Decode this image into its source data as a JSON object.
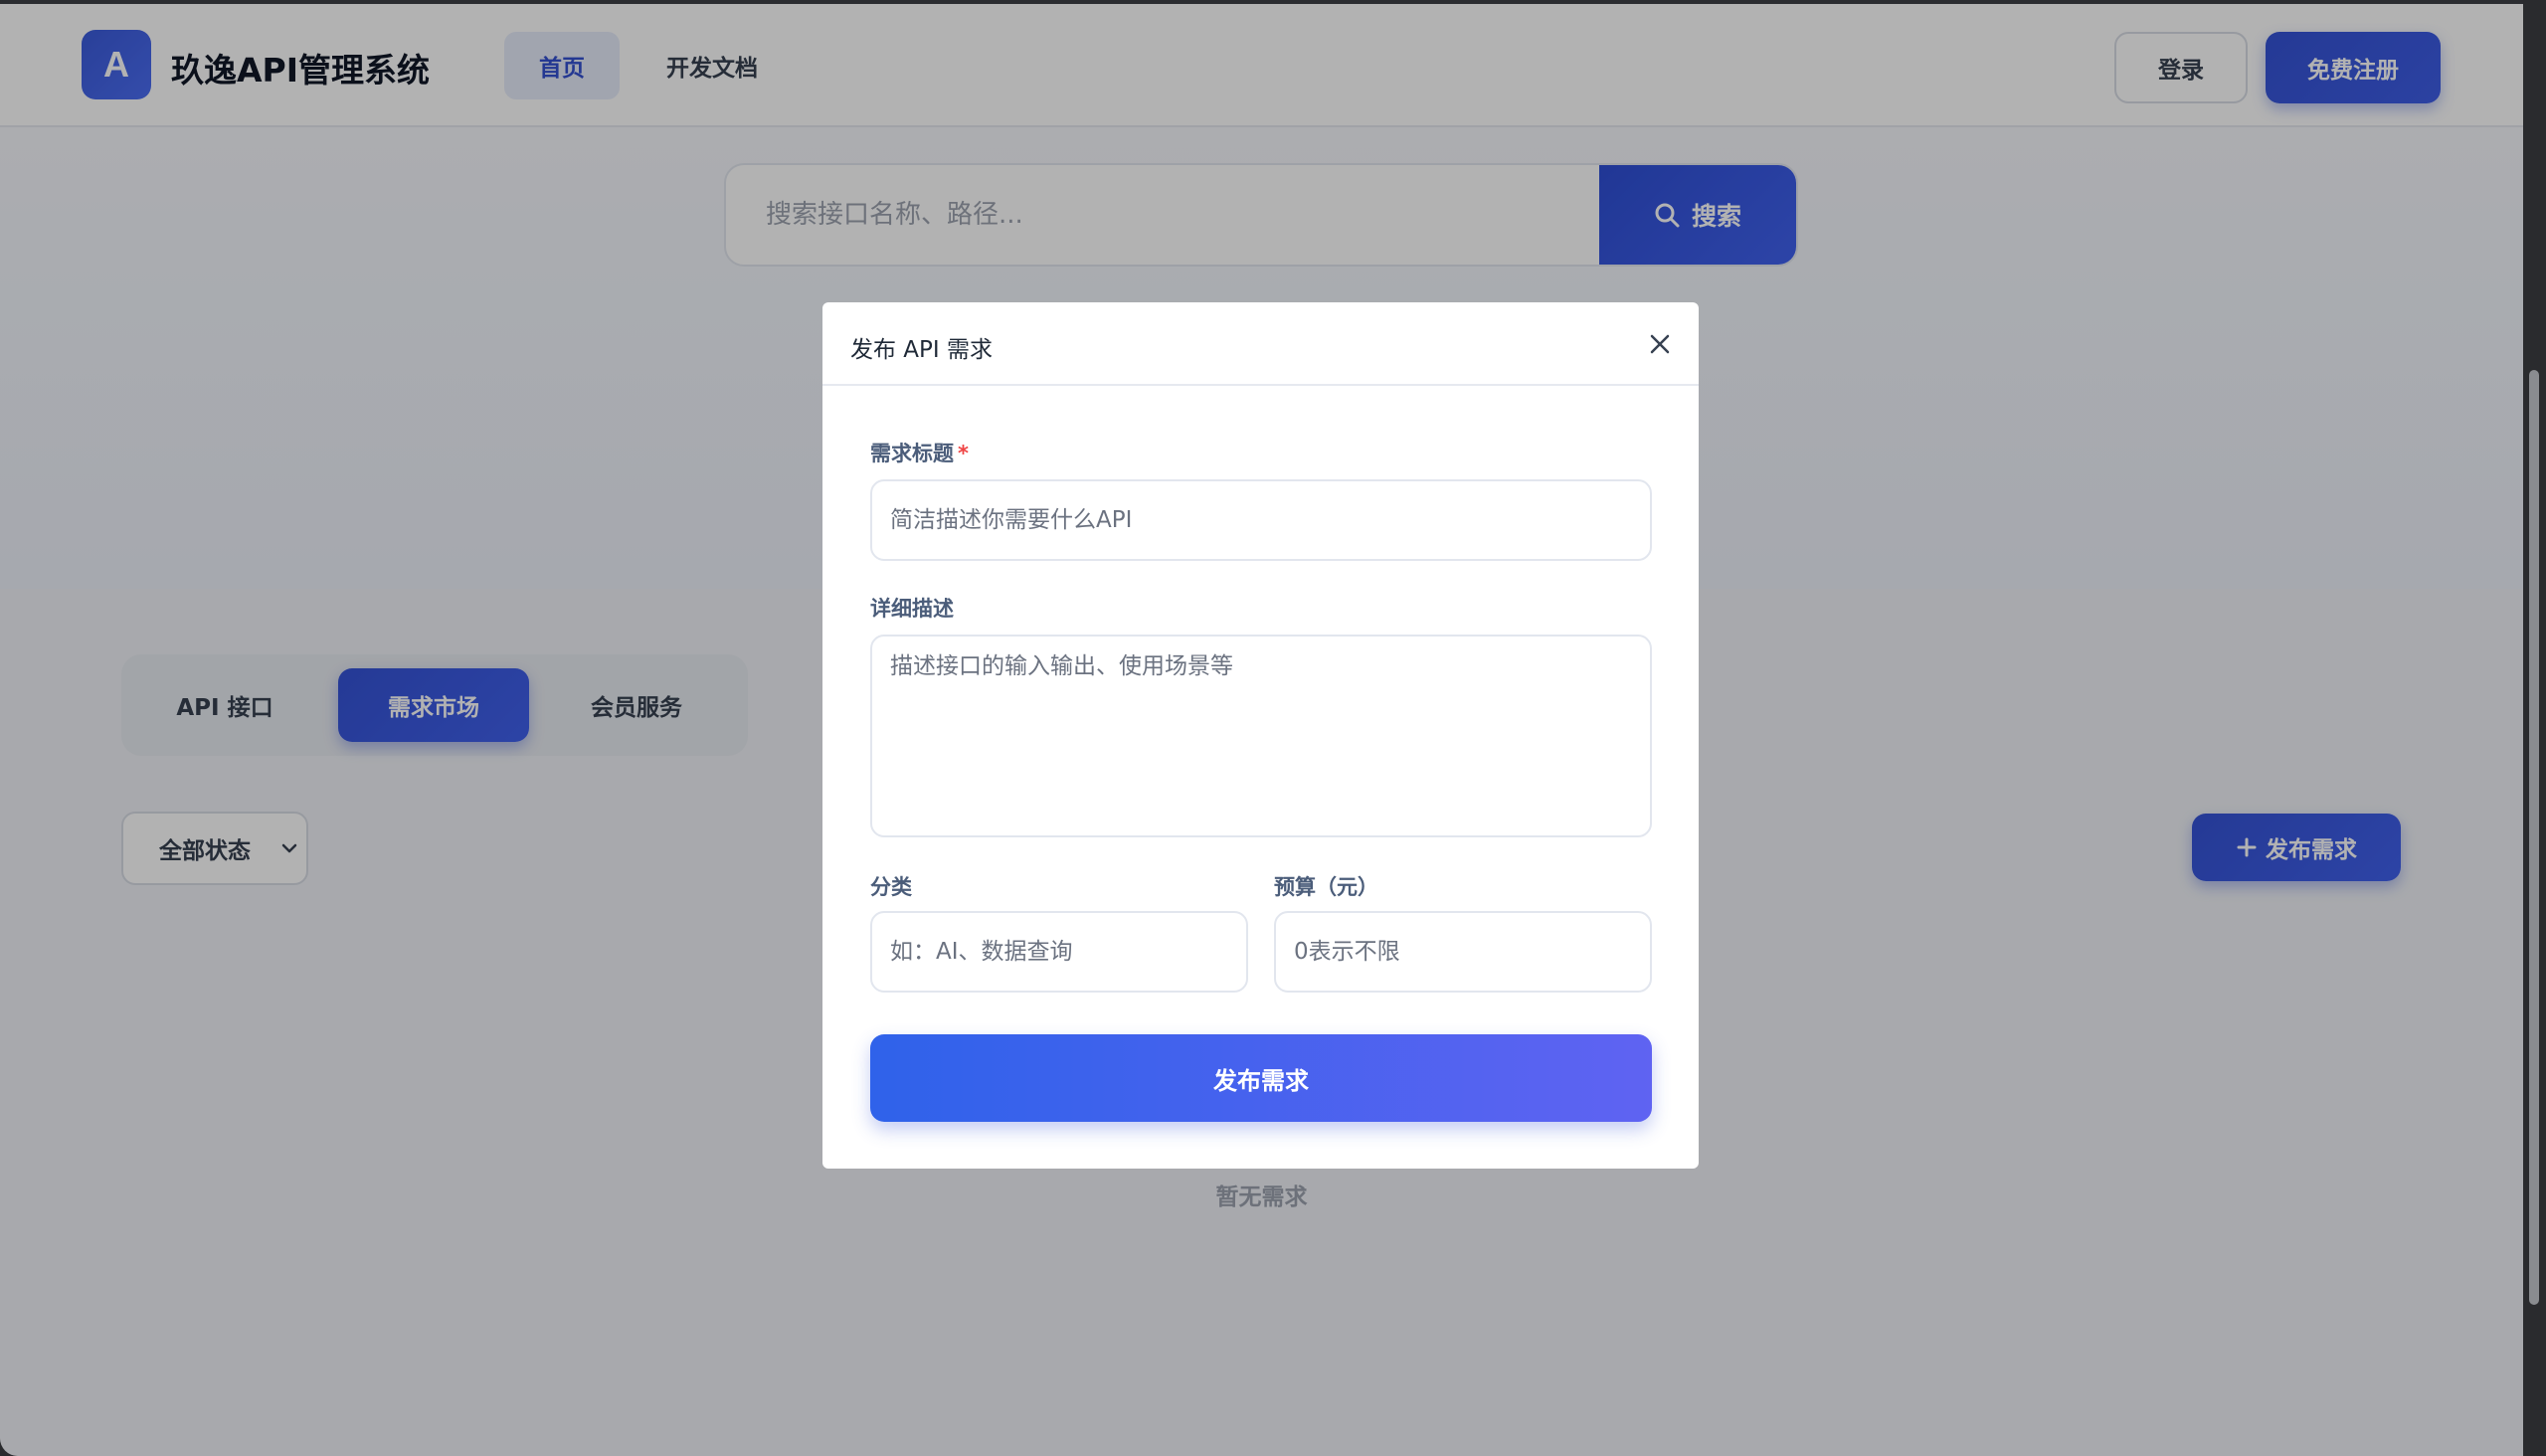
{
  "header": {
    "logo_letter": "A",
    "site_title": "玖逸API管理系统",
    "nav": [
      "首页",
      "开发文档"
    ],
    "login_label": "登录",
    "register_label": "免费注册"
  },
  "hero": {
    "search_placeholder": "搜索接口名称、路径...",
    "search_button": "搜索"
  },
  "tabs": [
    "API 接口",
    "需求市场",
    "会员服务"
  ],
  "active_tab": "需求市场",
  "filter": {
    "status_selected": "全部状态"
  },
  "publish_button": "发布需求",
  "empty_text": "暂无需求",
  "modal": {
    "title": "发布 API 需求",
    "fields": {
      "title_label": "需求标题",
      "required_mark": "*",
      "title_placeholder": "简洁描述你需要什么API",
      "desc_label": "详细描述",
      "desc_placeholder": "描述接口的输入输出、使用场景等",
      "category_label": "分类",
      "category_placeholder": "如：AI、数据查询",
      "budget_label": "预算（元）",
      "budget_placeholder": "0表示不限"
    },
    "submit_label": "发布需求"
  },
  "colors": {
    "primary": "#3553d6",
    "primary_gradient_end": "#5f63f2",
    "required": "#ef4444",
    "overlay": "rgba(0,0,0,0.30)"
  },
  "icons": {
    "search": "search-icon",
    "close": "close-icon",
    "plus": "plus-icon",
    "chevron": "chevron-down-icon"
  }
}
